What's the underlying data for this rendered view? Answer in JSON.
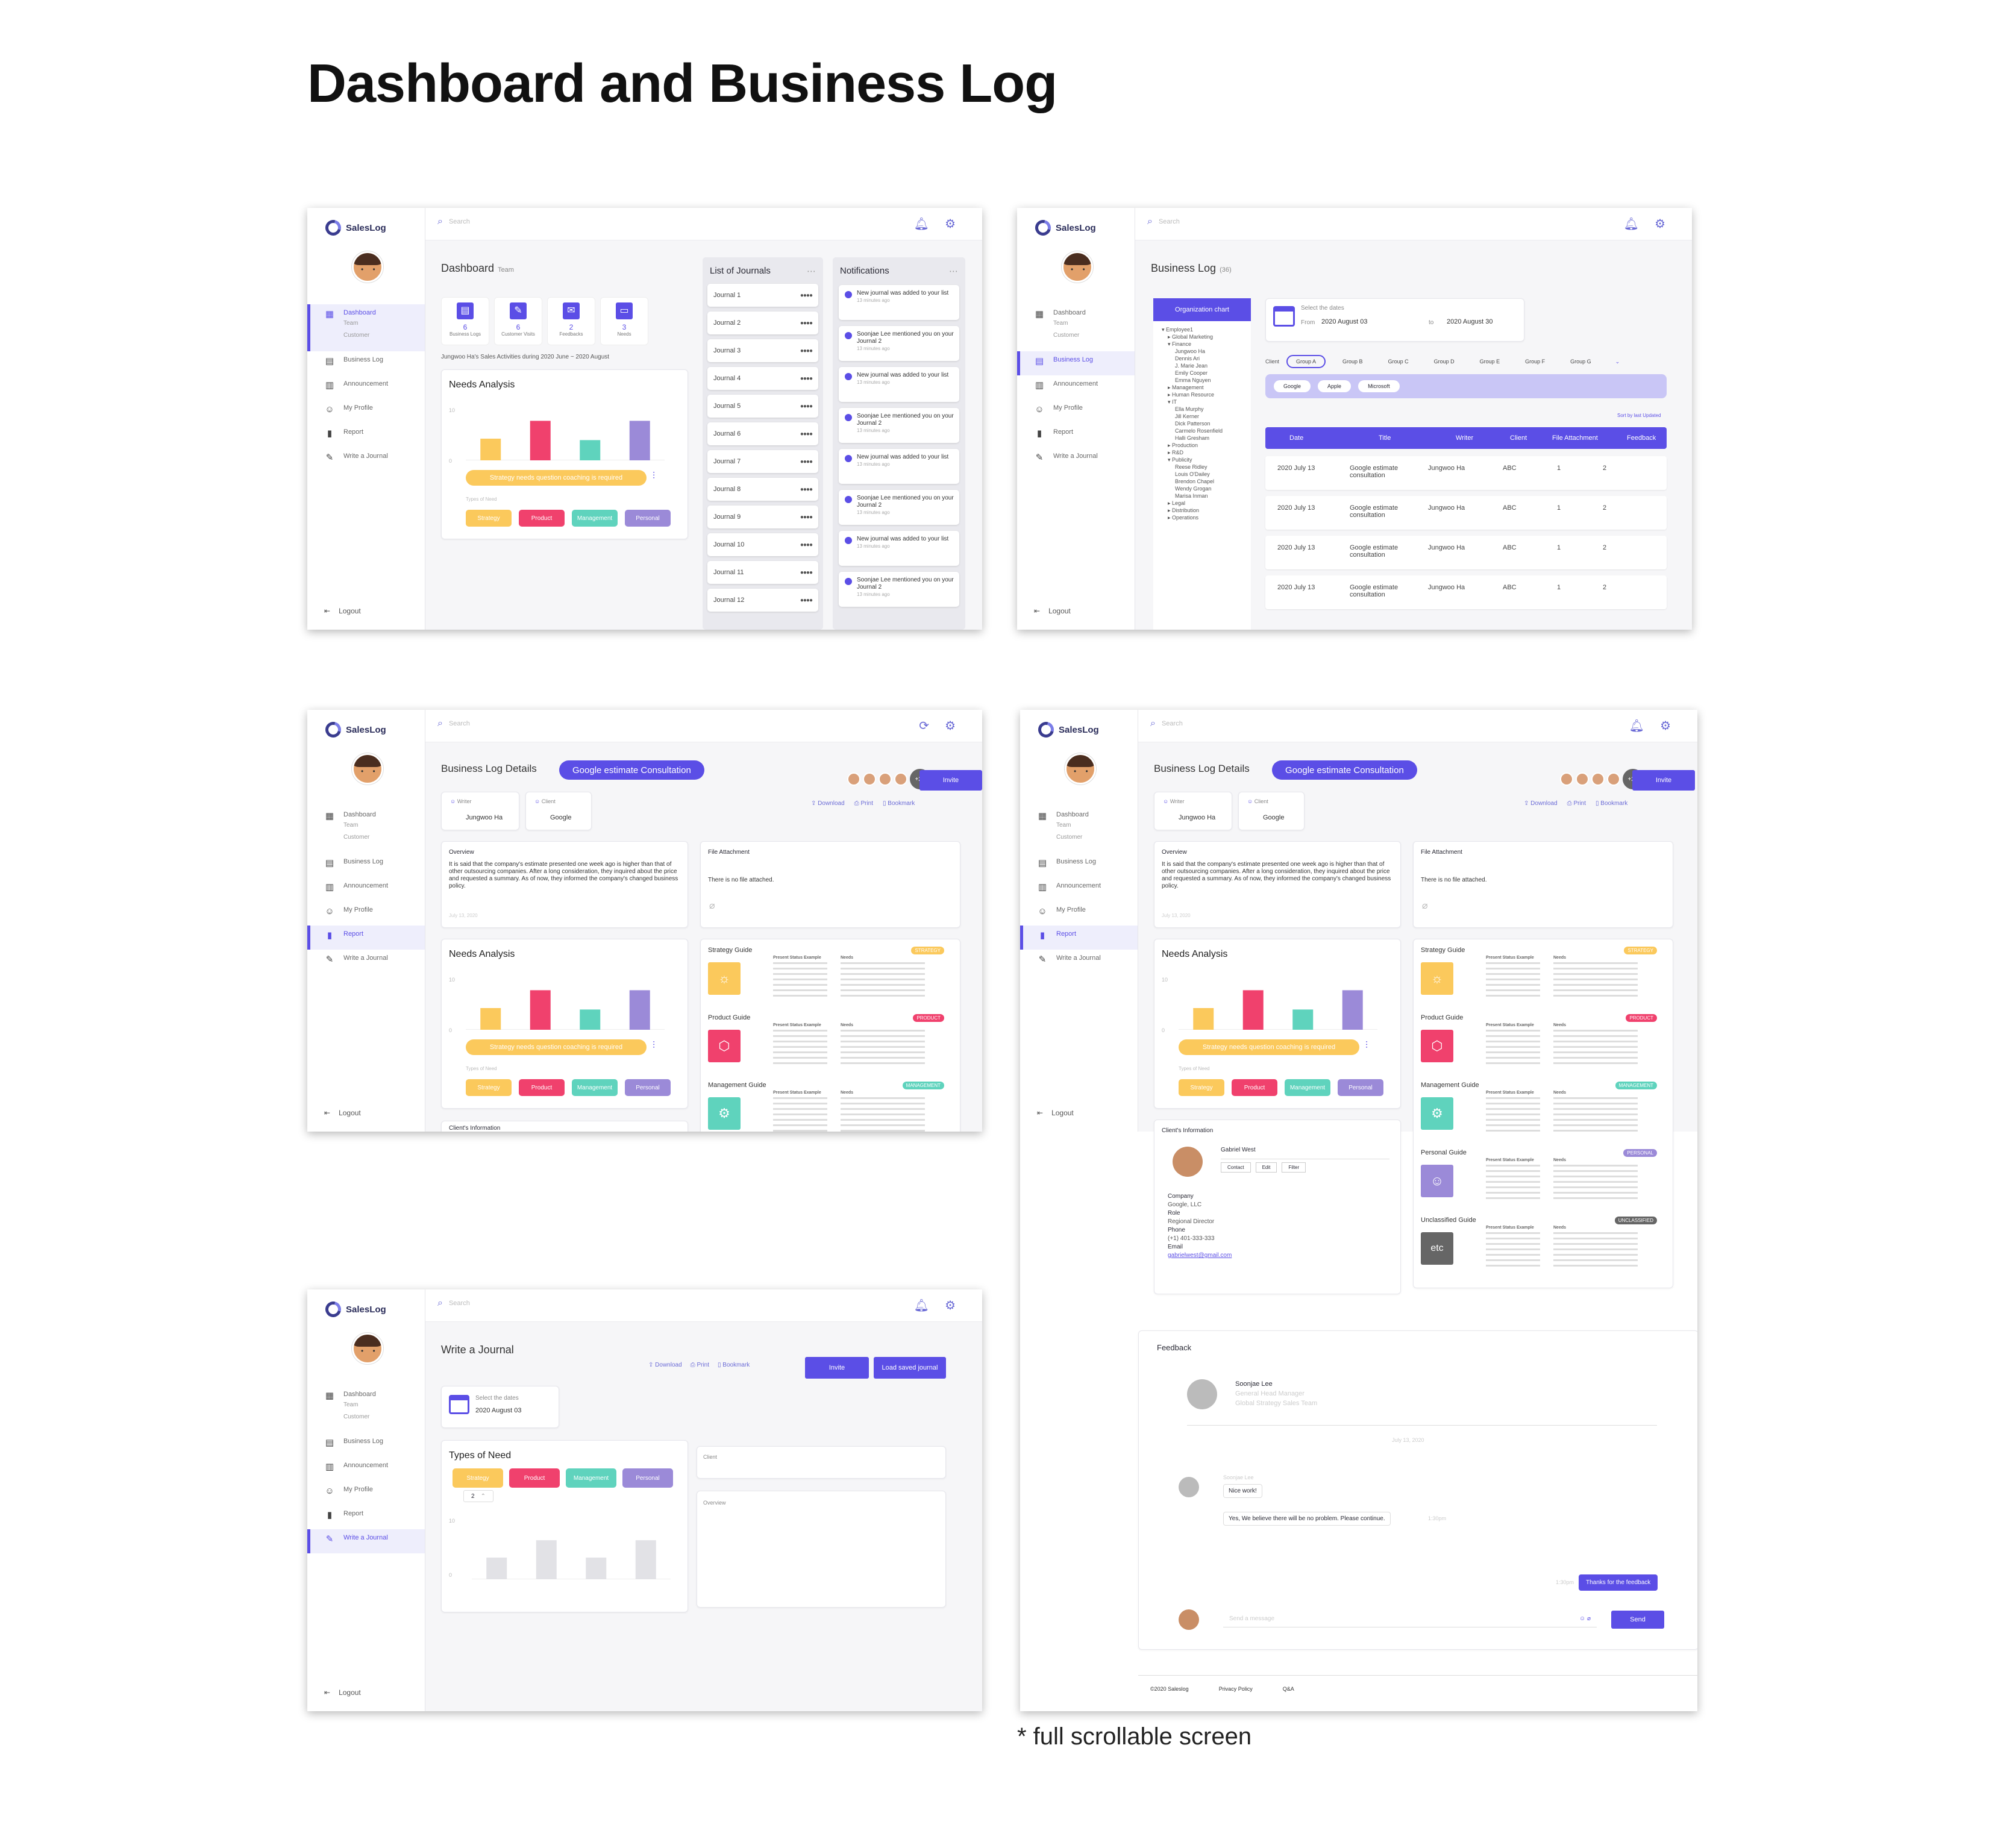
{
  "page_title": "Dashboard and Business Log",
  "scroll_note": "* full scrollable screen",
  "app": {
    "name": "SalesLog",
    "search_placeholder": "Search",
    "nav": {
      "dashboard": "Dashboard",
      "dashboard_sub1": "Team",
      "dashboard_sub2": "Customer",
      "business_log": "Business Log",
      "announcement": "Announcement",
      "my_profile": "My Profile",
      "report": "Report",
      "write_journal": "Write a Journal",
      "logout": "Logout"
    },
    "colors": {
      "accent": "#5b4ee6",
      "strategy": "#fbc95c",
      "product": "#f0416d",
      "management": "#5fd3bd",
      "personal": "#9b8ad8"
    }
  },
  "dashboard": {
    "title": "Dashboard",
    "subtitle": "Team",
    "stats": [
      {
        "num": "6",
        "label": "Business Logs"
      },
      {
        "num": "6",
        "label": "Customer Visits"
      },
      {
        "num": "2",
        "label": "Feedbacks"
      },
      {
        "num": "3",
        "label": "Needs"
      }
    ],
    "activity_text": "Jungwoo Ha's Sales Activities during 2020 June ~ 2020 August",
    "needs_title": "Needs Analysis",
    "needs_banner": "Strategy needs question coaching is required",
    "types_label": "Types of Need",
    "types": [
      "Strategy",
      "Product",
      "Management",
      "Personal"
    ],
    "y_max": "10",
    "y_min": "0",
    "journals_title": "List of Journals",
    "journals": [
      "Journal 1",
      "Journal 2",
      "Journal 3",
      "Journal 4",
      "Journal 5",
      "Journal 6",
      "Journal 7",
      "Journal 8",
      "Journal 9",
      "Journal 10",
      "Journal 11",
      "Journal 12"
    ],
    "notifications_title": "Notifications",
    "notifications": [
      {
        "text": "New journal was added to your list",
        "time": "13 minutes ago"
      },
      {
        "text": "Soonjae Lee mentioned you on your Journal 2",
        "time": "13 minutes ago"
      },
      {
        "text": "New journal was added to your list",
        "time": "13 minutes ago"
      },
      {
        "text": "Soonjae Lee mentioned you on your Journal 2",
        "time": "13 minutes ago"
      },
      {
        "text": "New journal was added to your list",
        "time": "13 minutes ago"
      },
      {
        "text": "Soonjae Lee mentioned you on your Journal 2",
        "time": "13 minutes ago"
      },
      {
        "text": "New journal was added to your list",
        "time": "13 minutes ago"
      },
      {
        "text": "Soonjae Lee mentioned you on your Journal 2",
        "time": "13 minutes ago"
      }
    ]
  },
  "business_log": {
    "title": "Business Log",
    "count": "(36)",
    "org_chart": "Organization chart",
    "tree": [
      "▾ Employee1",
      "▸ Global Marketing",
      "▾ Finance",
      "Jungwoo Ha",
      "Dennis Ari",
      "J. Marie Jean",
      "Emily Cooper",
      "Emma Nguyen",
      "▸ Management",
      "▸ Human Resource",
      "▾ IT",
      "Ella Murphy",
      "Jill Kerner",
      "Dick Patterson",
      "Carmelo Rosenfield",
      "Halli Gresham",
      "▸ Production",
      "▸ R&D",
      "▾ Publicity",
      "Reese Ridley",
      "Louis O'Dailey",
      "Brendon Chapel",
      "Wendy Grogan",
      "Marisa Inman",
      "▸ Legal",
      "▸ Distribution",
      "▸ Operations"
    ],
    "date_label": "Select the dates",
    "from_label": "From",
    "from_date": "2020 August 03",
    "to_label": "to",
    "to_date": "2020 August 30",
    "client_label": "Client",
    "groups": [
      "Group A",
      "Group B",
      "Group C",
      "Group D",
      "Group E",
      "Group F",
      "Group G"
    ],
    "clients": [
      "Google",
      "Apple",
      "Microsoft"
    ],
    "sort_link": "Sort by last Updated",
    "columns": [
      "Date",
      "Title",
      "Writer",
      "Client",
      "File Attachment",
      "Feedback"
    ],
    "rows": [
      {
        "date": "2020 July 13",
        "title": "Google estimate consultation",
        "writer": "Jungwoo Ha",
        "client": "ABC",
        "files": "1",
        "feedback": "2"
      },
      {
        "date": "2020 July 13",
        "title": "Google estimate consultation",
        "writer": "Jungwoo Ha",
        "client": "ABC",
        "files": "1",
        "feedback": "2"
      },
      {
        "date": "2020 July 13",
        "title": "Google estimate consultation",
        "writer": "Jungwoo Ha",
        "client": "ABC",
        "files": "1",
        "feedback": "2"
      },
      {
        "date": "2020 July 13",
        "title": "Google estimate consultation",
        "writer": "Jungwoo Ha",
        "client": "ABC",
        "files": "1",
        "feedback": "2"
      }
    ]
  },
  "details": {
    "title": "Business Log Details",
    "badge": "Google estimate Consultation",
    "more": "+25",
    "invite": "Invite",
    "download": "Download",
    "print": "Print",
    "bookmark": "Bookmark",
    "writer_label": "Writer",
    "writer": "Jungwoo Ha",
    "client_label": "Client",
    "client": "Google",
    "overview_title": "Overview",
    "overview_text": "It is said that the company's estimate presented one week ago is higher than that of other outsourcing companies. After a long consideration, they inquired about the price and requested a summary. As of now, they informed the company's changed business policy.",
    "overview_date": "July 13, 2020",
    "file_title": "File Attachment",
    "file_text": "There is no file attached.",
    "guides": [
      {
        "title": "Strategy Guide",
        "badge": "STRATEGY"
      },
      {
        "title": "Product Guide",
        "badge": "PRODUCT"
      },
      {
        "title": "Management Guide",
        "badge": "MANAGEMENT"
      },
      {
        "title": "Personal Guide",
        "badge": "PERSONAL"
      },
      {
        "title": "Unclassified Guide",
        "badge": "UNCLASSIFIED"
      }
    ],
    "guide_col1": "Present Status Example",
    "guide_col2": "Needs",
    "etc": "etc",
    "client_info_title": "Client's Information",
    "client_name": "Gabriel West",
    "client_actions": [
      "Contact",
      "Edit",
      "Filter"
    ],
    "company_label": "Company",
    "company": "Google, LLC",
    "role_label": "Role",
    "role": "Regional Director",
    "phone_label": "Phone",
    "phone": "(+1) 401-333-333",
    "email_label": "Email",
    "email": "gabrielwest@gmail.com",
    "feedback_title": "Feedback",
    "fb_name": "Soonjae Lee",
    "fb_role": "General Head Manager",
    "fb_dept": "Global Strategy Sales Team",
    "fb_date": "July 13, 2020",
    "fb_sender": "Soonjae Lee",
    "msg1": "Nice work!",
    "msg2": "Yes, We believe there will be no problem. Please continue.",
    "msg_time": "1:30pm",
    "reply": "Thanks for the feedback",
    "reply_time": "1:30pm",
    "input_placeholder": "Send a message",
    "send": "Send",
    "footer": [
      "©2020 Saleslog",
      "Privacy Policy",
      "Q&A"
    ],
    "client_info_cut": "Client's Information"
  },
  "write": {
    "title": "Write a Journal",
    "download": "Download",
    "print": "Print",
    "bookmark": "Bookmark",
    "invite": "Invite",
    "load": "Load saved journal",
    "date_label": "Select the dates",
    "date": "2020 August 03",
    "types_title": "Types of Need",
    "stepper": "2",
    "client_label": "Client",
    "overview_label": "Overview"
  }
}
